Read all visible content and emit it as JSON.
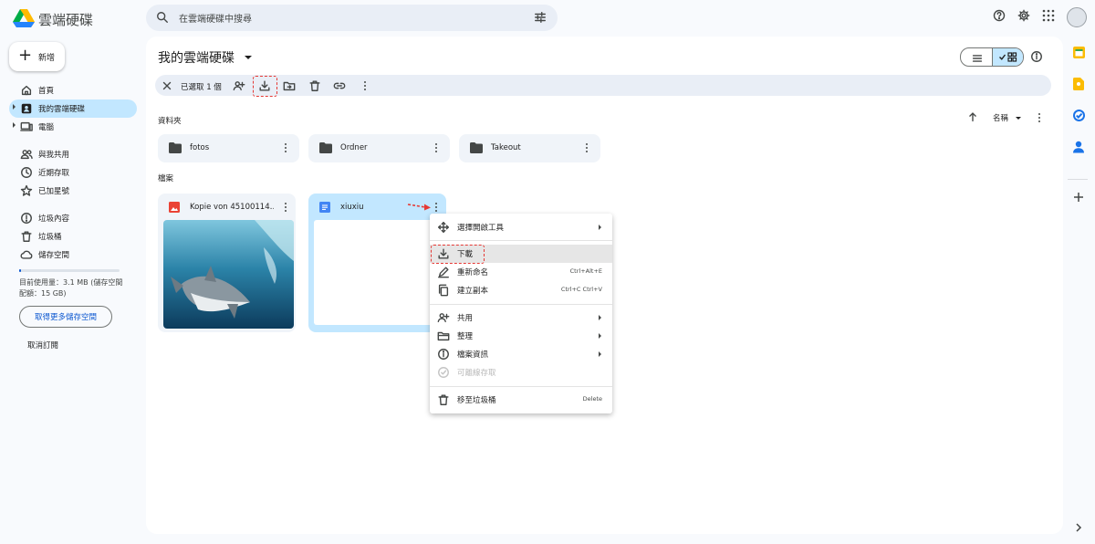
{
  "app": {
    "title": "雲端硬碟"
  },
  "search": {
    "placeholder": "在雲端硬碟中搜尋"
  },
  "nav": {
    "new_label": "新增",
    "items": [
      {
        "label": "首頁",
        "icon": "home-icon"
      },
      {
        "label": "我的雲端硬碟",
        "icon": "my-drive-icon",
        "active": true
      },
      {
        "label": "電腦",
        "icon": "computer-icon"
      },
      {
        "label": "與我共用",
        "icon": "shared-icon"
      },
      {
        "label": "近期存取",
        "icon": "recent-icon"
      },
      {
        "label": "已加星號",
        "icon": "star-icon"
      },
      {
        "label": "垃圾內容",
        "icon": "spam-icon"
      },
      {
        "label": "垃圾桶",
        "icon": "trash-icon"
      },
      {
        "label": "儲存空間",
        "icon": "cloud-icon"
      }
    ],
    "storage_text": "目前使用量：3.1 MB (儲存空間配額：15 GB)",
    "storage_fraction": 0.0002,
    "more_storage": "取得更多儲存空間",
    "unsubscribe": "取消訂閱"
  },
  "main": {
    "title": "我的雲端硬碟",
    "selection": {
      "count_text": "已選取 1 個"
    },
    "folders_label": "資料夾",
    "sort_label": "名稱",
    "files_label": "檔案",
    "folders": [
      {
        "name": "fotos"
      },
      {
        "name": "Ordner"
      },
      {
        "name": "Takeout"
      }
    ],
    "files": [
      {
        "name": "Kopie von 45100114…",
        "type": "image"
      },
      {
        "name": "xiuxiu",
        "type": "document",
        "selected": true
      }
    ]
  },
  "context_menu": {
    "items": [
      {
        "label": "選擇開啟工具",
        "shortcut": "",
        "submenu": true,
        "icon": "open-with-icon"
      },
      {
        "label": "下載",
        "shortcut": "",
        "highlighted": true,
        "icon": "download-icon"
      },
      {
        "label": "重新命名",
        "shortcut": "Ctrl+Alt+E",
        "icon": "rename-icon"
      },
      {
        "label": "建立副本",
        "shortcut": "Ctrl+C Ctrl+V",
        "icon": "copy-icon"
      },
      {
        "label": "共用",
        "shortcut": "",
        "submenu": true,
        "icon": "share-icon"
      },
      {
        "label": "整理",
        "shortcut": "",
        "submenu": true,
        "icon": "organize-icon"
      },
      {
        "label": "檔案資訊",
        "shortcut": "",
        "submenu": true,
        "icon": "info-icon"
      },
      {
        "label": "可離線存取",
        "shortcut": "",
        "disabled": true,
        "icon": "offline-icon"
      },
      {
        "label": "移至垃圾桶",
        "shortcut": "Delete",
        "icon": "trash-icon"
      }
    ]
  },
  "colors": {
    "accent": "#0b57d0",
    "selected_bg": "#c2e7ff",
    "annotation": "#e53935"
  }
}
